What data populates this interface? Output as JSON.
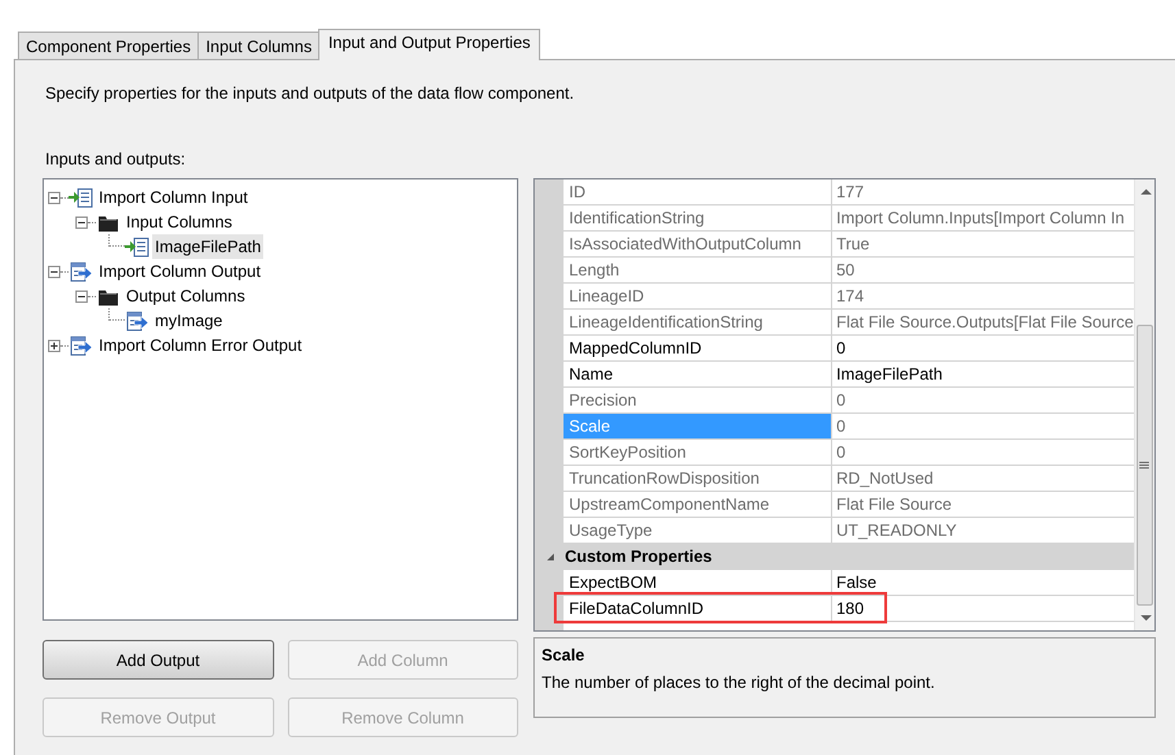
{
  "tabs": [
    {
      "label": "Component Properties",
      "selected": false
    },
    {
      "label": "Input Columns",
      "selected": false
    },
    {
      "label": "Input and Output Properties",
      "selected": true
    }
  ],
  "description": "Specify properties for the inputs and outputs of the data flow component.",
  "tree_label": "Inputs and outputs:",
  "tree": [
    {
      "label": "Import Column Input",
      "kind": "input",
      "expanded": true,
      "selected": false,
      "children": [
        {
          "label": "Input Columns",
          "kind": "folder",
          "expanded": true,
          "selected": false,
          "children": [
            {
              "label": "ImageFilePath",
              "kind": "input",
              "selected": true
            }
          ]
        }
      ]
    },
    {
      "label": "Import Column Output",
      "kind": "output",
      "expanded": true,
      "selected": false,
      "children": [
        {
          "label": "Output Columns",
          "kind": "folder",
          "expanded": true,
          "selected": false,
          "children": [
            {
              "label": "myImage",
              "kind": "output",
              "selected": false
            }
          ]
        }
      ]
    },
    {
      "label": "Import Column Error Output",
      "kind": "output",
      "expanded": false,
      "selected": false
    }
  ],
  "properties": [
    {
      "kind": "property",
      "name": "ID",
      "value": "177",
      "readonly": true,
      "selected": false,
      "highlighted": false
    },
    {
      "kind": "property",
      "name": "IdentificationString",
      "value": "Import Column.Inputs[Import Column In",
      "readonly": true,
      "selected": false,
      "highlighted": false
    },
    {
      "kind": "property",
      "name": "IsAssociatedWithOutputColumn",
      "value": "True",
      "readonly": true,
      "selected": false,
      "highlighted": false
    },
    {
      "kind": "property",
      "name": "Length",
      "value": "50",
      "readonly": true,
      "selected": false,
      "highlighted": false
    },
    {
      "kind": "property",
      "name": "LineageID",
      "value": "174",
      "readonly": true,
      "selected": false,
      "highlighted": false
    },
    {
      "kind": "property",
      "name": "LineageIdentificationString",
      "value": "Flat File Source.Outputs[Flat File Source",
      "readonly": true,
      "selected": false,
      "highlighted": false
    },
    {
      "kind": "property",
      "name": "MappedColumnID",
      "value": "0",
      "readonly": false,
      "selected": false,
      "highlighted": false
    },
    {
      "kind": "property",
      "name": "Name",
      "value": "ImageFilePath",
      "readonly": false,
      "selected": false,
      "highlighted": false
    },
    {
      "kind": "property",
      "name": "Precision",
      "value": "0",
      "readonly": true,
      "selected": false,
      "highlighted": false
    },
    {
      "kind": "property",
      "name": "Scale",
      "value": "0",
      "readonly": true,
      "selected": true,
      "highlighted": false
    },
    {
      "kind": "property",
      "name": "SortKeyPosition",
      "value": "0",
      "readonly": true,
      "selected": false,
      "highlighted": false
    },
    {
      "kind": "property",
      "name": "TruncationRowDisposition",
      "value": "RD_NotUsed",
      "readonly": true,
      "selected": false,
      "highlighted": false
    },
    {
      "kind": "property",
      "name": "UpstreamComponentName",
      "value": "Flat File Source",
      "readonly": true,
      "selected": false,
      "highlighted": false
    },
    {
      "kind": "property",
      "name": "UsageType",
      "value": "UT_READONLY",
      "readonly": true,
      "selected": false,
      "highlighted": false
    },
    {
      "kind": "category",
      "name": "Custom Properties",
      "expanded": true
    },
    {
      "kind": "property",
      "name": "ExpectBOM",
      "value": "False",
      "readonly": false,
      "selected": false,
      "highlighted": false
    },
    {
      "kind": "property",
      "name": "FileDataColumnID",
      "value": "180",
      "readonly": false,
      "selected": false,
      "highlighted": true
    }
  ],
  "help": {
    "title": "Scale",
    "text": "The number of places to the right of the decimal point."
  },
  "buttons": [
    {
      "label": "Add Output",
      "disabled": false
    },
    {
      "label": "Add Column",
      "disabled": true
    },
    {
      "label": "Remove Output",
      "disabled": true
    },
    {
      "label": "Remove Column",
      "disabled": true
    }
  ]
}
